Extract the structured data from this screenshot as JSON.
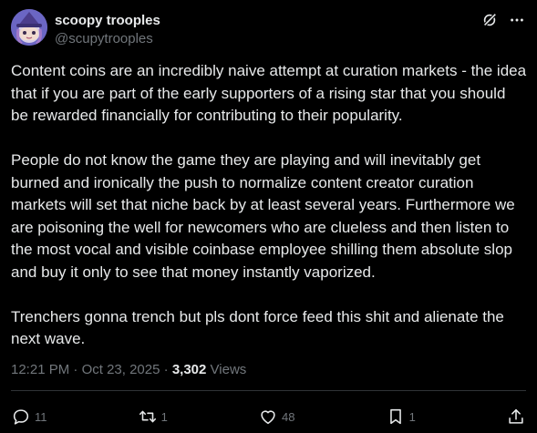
{
  "author": {
    "display_name": "scoopy trooples",
    "handle": "@scupytrooples"
  },
  "icons": {
    "grok": "grok-icon",
    "more": "more-icon",
    "reply": "reply-icon",
    "retweet": "retweet-icon",
    "like": "like-icon",
    "bookmark": "bookmark-icon",
    "share": "share-icon"
  },
  "post": {
    "paragraphs": [
      "Content coins are an incredibly naive attempt at curation markets - the idea that if you are part of the early supporters of a rising star that you should be rewarded financially for contributing to their popularity.",
      "People do not know the game they are playing and will inevitably get burned and ironically the push to normalize content creator curation markets will set that niche back by at least several years. Furthermore we are poisoning the well for newcomers who are clueless and then listen to the most vocal and visible coinbase employee shilling them absolute slop and buy it only to see that money instantly vaporized.",
      "Trenchers gonna trench but pls dont force feed this shit and alienate the next wave."
    ],
    "time": "12:21 PM",
    "date": "Oct 23, 2025",
    "views_count": "3,302",
    "views_label": "Views"
  },
  "stats": {
    "replies": "11",
    "retweets": "1",
    "likes": "48",
    "bookmarks": "1"
  },
  "colors": {
    "background": "#000000",
    "text_primary": "#e7e9ea",
    "text_secondary": "#71767b",
    "divider": "#2f3336"
  }
}
